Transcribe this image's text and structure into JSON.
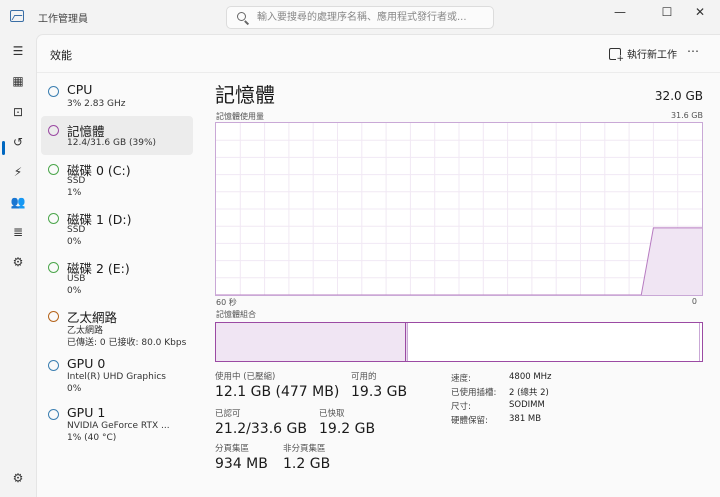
{
  "window": {
    "title": "工作管理員",
    "search_placeholder": "輸入要搜尋的處理序名稱、應用程式發行者或...",
    "minimize": "—",
    "maximize": "☐",
    "close": "✕"
  },
  "header": {
    "title": "效能",
    "run_new_task": "執行新工作",
    "more": "⋯"
  },
  "nav_icons": [
    "hamburger-icon",
    "processes-icon",
    "performance-icon",
    "app-history-icon",
    "startup-icon",
    "users-icon",
    "details-icon",
    "services-icon",
    "settings-icon"
  ],
  "perf_items": [
    {
      "name": "CPU",
      "lines": [
        "3%  2.83 GHz"
      ],
      "color": "#3c7fb1"
    },
    {
      "name": "記憶體",
      "lines": [
        "12.4/31.6 GB (39%)"
      ],
      "color": "#9b4aa3"
    },
    {
      "name": "磁碟 0 (C:)",
      "lines": [
        "SSD",
        "1%"
      ],
      "color": "#4ca64c"
    },
    {
      "name": "磁碟 1 (D:)",
      "lines": [
        "SSD",
        "0%"
      ],
      "color": "#4ca64c"
    },
    {
      "name": "磁碟 2 (E:)",
      "lines": [
        "USB",
        "0%"
      ],
      "color": "#4ca64c"
    },
    {
      "name": "乙太網路",
      "lines": [
        "乙太網路",
        "已傳送: 0 已接收: 80.0 Kbps"
      ],
      "color": "#b5651d"
    },
    {
      "name": "GPU 0",
      "lines": [
        "Intel(R) UHD Graphics",
        "0%"
      ],
      "color": "#3c7fb1"
    },
    {
      "name": "GPU 1",
      "lines": [
        "NVIDIA GeForce RTX ...",
        "1% (40 °C)"
      ],
      "color": "#3c7fb1"
    }
  ],
  "detail": {
    "title": "記憶體",
    "total": "32.0 GB",
    "usage_label": "記憶體使用量",
    "usage_max": "31.6 GB",
    "axis_left": "60 秒",
    "axis_right": "0",
    "composition_label": "記憶體組合",
    "composition": {
      "in_use_fraction": 0.39,
      "modified_fraction": 0.005,
      "standby_fraction": 0.6
    }
  },
  "usage_graph": {
    "type": "area",
    "x": [
      60,
      7.5,
      6,
      0
    ],
    "y_fraction": [
      0,
      0,
      0.39,
      0.39
    ]
  },
  "stats": {
    "in_use_label": "使用中 (已壓縮)",
    "in_use_value": "12.1 GB (477 MB)",
    "available_label": "可用的",
    "available_value": "19.3 GB",
    "committed_label": "已認可",
    "committed_value": "21.2/33.6 GB",
    "cached_label": "已快取",
    "cached_value": "19.2 GB",
    "paged_label": "分頁集區",
    "paged_value": "934 MB",
    "nonpaged_label": "非分頁集區",
    "nonpaged_value": "1.2 GB"
  },
  "props": [
    {
      "label": "速度:",
      "value": "4800 MHz"
    },
    {
      "label": "已使用插槽:",
      "value": "2 (總共 2)"
    },
    {
      "label": "尺寸:",
      "value": "SODIMM"
    },
    {
      "label": "硬體保留:",
      "value": "381 MB"
    }
  ],
  "colors": {
    "accent": "#0067c0",
    "memory": "#9b4aa3"
  }
}
